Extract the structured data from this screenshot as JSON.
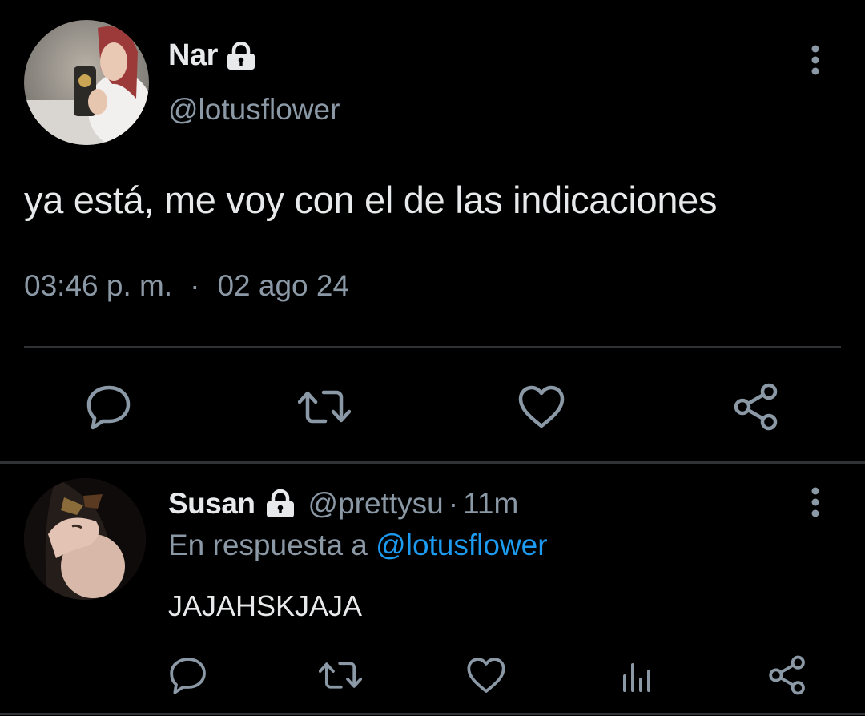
{
  "main_tweet": {
    "author_name": "Nar",
    "handle": "@lotusflower",
    "text": "ya está, me voy con el de las indicaciones",
    "time": "03:46 p. m.",
    "separator": "·",
    "date": "02 ago 24",
    "locked": true,
    "actions": [
      "reply-icon",
      "retweet-icon",
      "like-icon",
      "share-icon"
    ]
  },
  "reply": {
    "author_name": "Susan",
    "handle": "@prettysu",
    "separator": "·",
    "time": "11m",
    "replying_to_prefix": "En respuesta a",
    "replying_to_handle": "@lotusflower",
    "text": "JAJAHSKJAJA",
    "locked": true,
    "actions": [
      "reply-icon",
      "retweet-icon",
      "like-icon",
      "analytics-icon",
      "share-icon"
    ]
  },
  "colors": {
    "background": "#000000",
    "primary_text": "#e7e9ea",
    "secondary_text": "#8b98a5",
    "link": "#1d9bf0",
    "divider": "#2f3336"
  }
}
